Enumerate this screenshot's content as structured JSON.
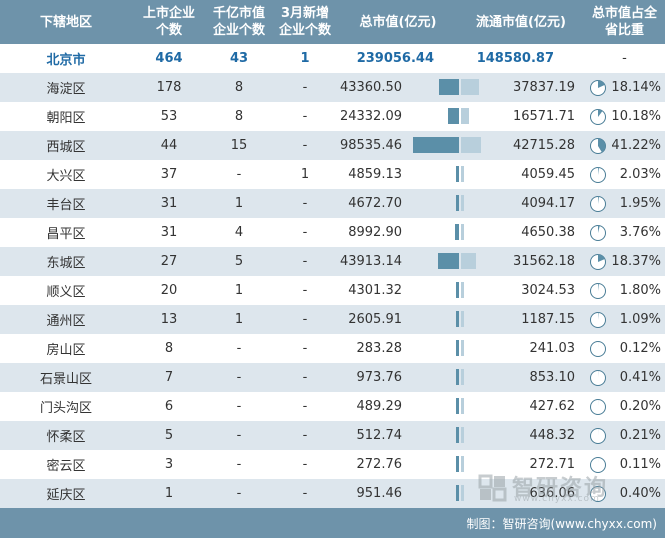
{
  "headers": {
    "district": "下辖地区",
    "listed": "上市企业\n个数",
    "trillion": "千亿市值\n企业个数",
    "new_march": "3月新增\n企业个数",
    "total_mv": "总市值(亿元)",
    "float_mv": "流通市值(亿元)",
    "share": "总市值占全\n省比重"
  },
  "total_row": {
    "district": "北京市",
    "listed": "464",
    "trillion": "43",
    "new_march": "1",
    "total_mv": "239056.44",
    "float_mv": "148580.87",
    "share": "-"
  },
  "chart_data": {
    "type": "table",
    "columns": [
      "下辖地区",
      "上市企业个数",
      "千亿市值企业个数",
      "3月新增企业个数",
      "总市值(亿元)",
      "流通市值(亿元)",
      "总市值占全省比重"
    ],
    "rows": [
      {
        "district": "海淀区",
        "listed": "178",
        "trillion": "8",
        "new_march": "-",
        "total_mv": "43360.50",
        "float_mv": "37837.19",
        "share": "18.14%",
        "share_value": 18.14,
        "total_value": 43360.5,
        "float_value": 37837.19
      },
      {
        "district": "朝阳区",
        "listed": "53",
        "trillion": "8",
        "new_march": "-",
        "total_mv": "24332.09",
        "float_mv": "16571.71",
        "share": "10.18%",
        "share_value": 10.18,
        "total_value": 24332.09,
        "float_value": 16571.71
      },
      {
        "district": "西城区",
        "listed": "44",
        "trillion": "15",
        "new_march": "-",
        "total_mv": "98535.46",
        "float_mv": "42715.28",
        "share": "41.22%",
        "share_value": 41.22,
        "total_value": 98535.46,
        "float_value": 42715.28
      },
      {
        "district": "大兴区",
        "listed": "37",
        "trillion": "-",
        "new_march": "1",
        "total_mv": "4859.13",
        "float_mv": "4059.45",
        "share": "2.03%",
        "share_value": 2.03,
        "total_value": 4859.13,
        "float_value": 4059.45
      },
      {
        "district": "丰台区",
        "listed": "31",
        "trillion": "1",
        "new_march": "-",
        "total_mv": "4672.70",
        "float_mv": "4094.17",
        "share": "1.95%",
        "share_value": 1.95,
        "total_value": 4672.7,
        "float_value": 4094.17
      },
      {
        "district": "昌平区",
        "listed": "31",
        "trillion": "4",
        "new_march": "-",
        "total_mv": "8992.90",
        "float_mv": "4650.38",
        "share": "3.76%",
        "share_value": 3.76,
        "total_value": 8992.9,
        "float_value": 4650.38
      },
      {
        "district": "东城区",
        "listed": "27",
        "trillion": "5",
        "new_march": "-",
        "total_mv": "43913.14",
        "float_mv": "31562.18",
        "share": "18.37%",
        "share_value": 18.37,
        "total_value": 43913.14,
        "float_value": 31562.18
      },
      {
        "district": "顺义区",
        "listed": "20",
        "trillion": "1",
        "new_march": "-",
        "total_mv": "4301.32",
        "float_mv": "3024.53",
        "share": "1.80%",
        "share_value": 1.8,
        "total_value": 4301.32,
        "float_value": 3024.53
      },
      {
        "district": "通州区",
        "listed": "13",
        "trillion": "1",
        "new_march": "-",
        "total_mv": "2605.91",
        "float_mv": "1187.15",
        "share": "1.09%",
        "share_value": 1.09,
        "total_value": 2605.91,
        "float_value": 1187.15
      },
      {
        "district": "房山区",
        "listed": "8",
        "trillion": "-",
        "new_march": "-",
        "total_mv": "283.28",
        "float_mv": "241.03",
        "share": "0.12%",
        "share_value": 0.12,
        "total_value": 283.28,
        "float_value": 241.03
      },
      {
        "district": "石景山区",
        "listed": "7",
        "trillion": "-",
        "new_march": "-",
        "total_mv": "973.76",
        "float_mv": "853.10",
        "share": "0.41%",
        "share_value": 0.41,
        "total_value": 973.76,
        "float_value": 853.1
      },
      {
        "district": "门头沟区",
        "listed": "6",
        "trillion": "-",
        "new_march": "-",
        "total_mv": "489.29",
        "float_mv": "427.62",
        "share": "0.20%",
        "share_value": 0.2,
        "total_value": 489.29,
        "float_value": 427.62
      },
      {
        "district": "怀柔区",
        "listed": "5",
        "trillion": "-",
        "new_march": "-",
        "total_mv": "512.74",
        "float_mv": "448.32",
        "share": "0.21%",
        "share_value": 0.21,
        "total_value": 512.74,
        "float_value": 448.32
      },
      {
        "district": "密云区",
        "listed": "3",
        "trillion": "-",
        "new_march": "-",
        "total_mv": "272.76",
        "float_mv": "272.71",
        "share": "0.11%",
        "share_value": 0.11,
        "total_value": 272.76,
        "float_value": 272.71
      },
      {
        "district": "延庆区",
        "listed": "1",
        "trillion": "-",
        "new_march": "-",
        "total_mv": "951.46",
        "float_mv": "636.06",
        "share": "0.40%",
        "share_value": 0.4,
        "total_value": 951.46,
        "float_value": 636.06
      }
    ]
  },
  "colors": {
    "header_bg": "#6e93aa",
    "alt_row": "#dde6ed",
    "total_text": "#1f6aa5",
    "bar_total": "#5b8fa8",
    "bar_float": "#b8cfdc",
    "pie_fill": "#5b8fa8",
    "pie_stroke": "#4a7d96"
  },
  "footer": {
    "source": "制图：智研咨询(www.chyxx.com)"
  },
  "watermark": {
    "brand": "智研咨询",
    "url": "www.chyxx.com"
  }
}
